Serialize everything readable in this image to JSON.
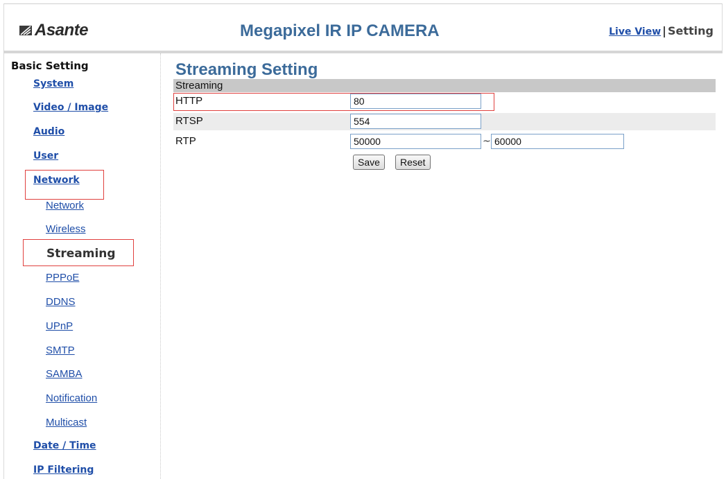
{
  "header": {
    "logo_text": "Asante",
    "title": "Megapixel IR IP CAMERA",
    "nav": {
      "live_view": "Live View",
      "separator": "|",
      "setting": "Setting"
    }
  },
  "sidebar": {
    "heading": "Basic Setting",
    "items": [
      {
        "label": "System"
      },
      {
        "label": "Video / Image"
      },
      {
        "label": "Audio"
      },
      {
        "label": "User"
      },
      {
        "label": "Network"
      }
    ],
    "network_sub": [
      {
        "label": "Network"
      },
      {
        "label": "Wireless"
      },
      {
        "label": "Streaming"
      },
      {
        "label": "PPPoE"
      },
      {
        "label": "DDNS"
      },
      {
        "label": "UPnP"
      },
      {
        "label": "SMTP"
      },
      {
        "label": "SAMBA"
      },
      {
        "label": "Notification"
      },
      {
        "label": "Multicast"
      }
    ],
    "bottom_items": [
      {
        "label": "Date / Time"
      },
      {
        "label": "IP Filtering"
      }
    ]
  },
  "main": {
    "title": "Streaming Setting",
    "section": "Streaming",
    "http": {
      "label": "HTTP",
      "value": "80"
    },
    "rtsp": {
      "label": "RTSP",
      "value": "554"
    },
    "rtp": {
      "label": "RTP",
      "from": "50000",
      "separator": "~",
      "to": "60000"
    },
    "save_label": "Save",
    "reset_label": "Reset"
  },
  "colors": {
    "accent": "#3c6b9a",
    "link": "#1f4ea8",
    "highlight_box": "#e0403e",
    "section_bar": "#c8c8c8"
  }
}
